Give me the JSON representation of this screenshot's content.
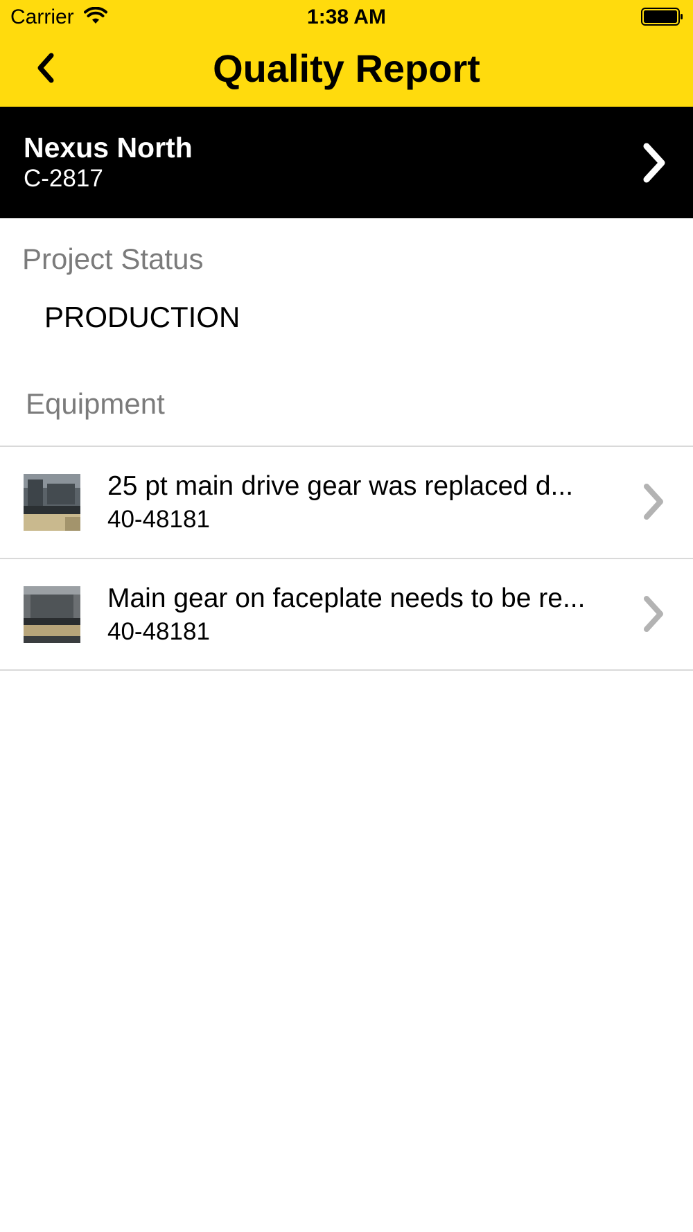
{
  "status_bar": {
    "carrier": "Carrier",
    "time": "1:38 AM"
  },
  "nav": {
    "title": "Quality Report",
    "back_icon": "chevron-left-icon"
  },
  "project": {
    "name": "Nexus North",
    "code": "C-2817",
    "chevron_icon": "chevron-right-icon"
  },
  "status_section": {
    "label": "Project Status",
    "value": "PRODUCTION"
  },
  "equipment_section": {
    "label": "Equipment",
    "items": [
      {
        "title": "25 pt main drive gear was replaced d...",
        "subtitle": "40-48181"
      },
      {
        "title": "Main gear on faceplate needs to be re...",
        "subtitle": "40-48181"
      }
    ]
  },
  "colors": {
    "accent": "#FFDB0D",
    "header_bg": "#000000",
    "secondary_text": "#7b7b7b",
    "chevron_gray": "#b3b3b3"
  }
}
